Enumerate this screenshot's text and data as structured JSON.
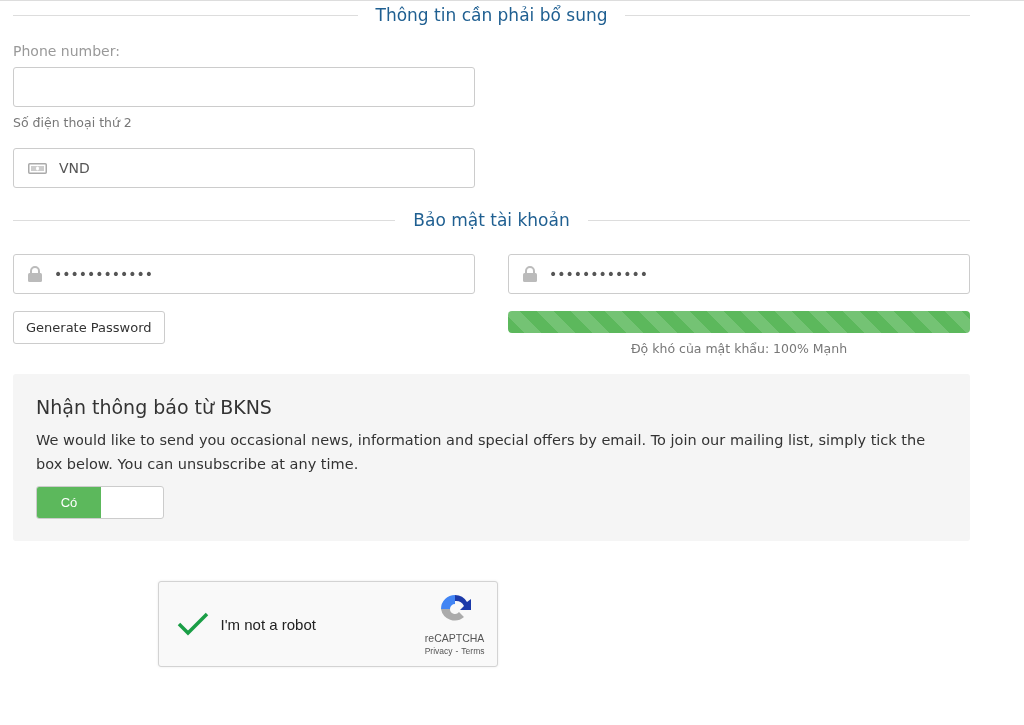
{
  "section_1": {
    "title": "Thông tin cần phải bổ sung"
  },
  "phone": {
    "label": "Phone number:",
    "help": "Số điện thoại thứ 2"
  },
  "currency": {
    "value": "VND"
  },
  "section_2": {
    "title": "Bảo mật tài khoản"
  },
  "password": {
    "value": "••••••••••••"
  },
  "password_confirm": {
    "value": "••••••••••••"
  },
  "generate_button": "Generate Password",
  "strength": {
    "level": 1,
    "text": "Độ khó của mật khẩu: 100% Mạnh"
  },
  "newsletter": {
    "title": "Nhận thông báo từ BKNS",
    "text": "We would like to send you occasional news, information and special offers by email. To join our mailing list, simply tick the box below. You can unsubscribe at any time.",
    "toggle": {
      "label": "Có",
      "on": true
    }
  },
  "captcha": {
    "label": "I'm not a robot",
    "checked": true,
    "brand": "reCAPTCHA",
    "privacy": "Privacy",
    "separator": "-",
    "terms": "Terms"
  }
}
